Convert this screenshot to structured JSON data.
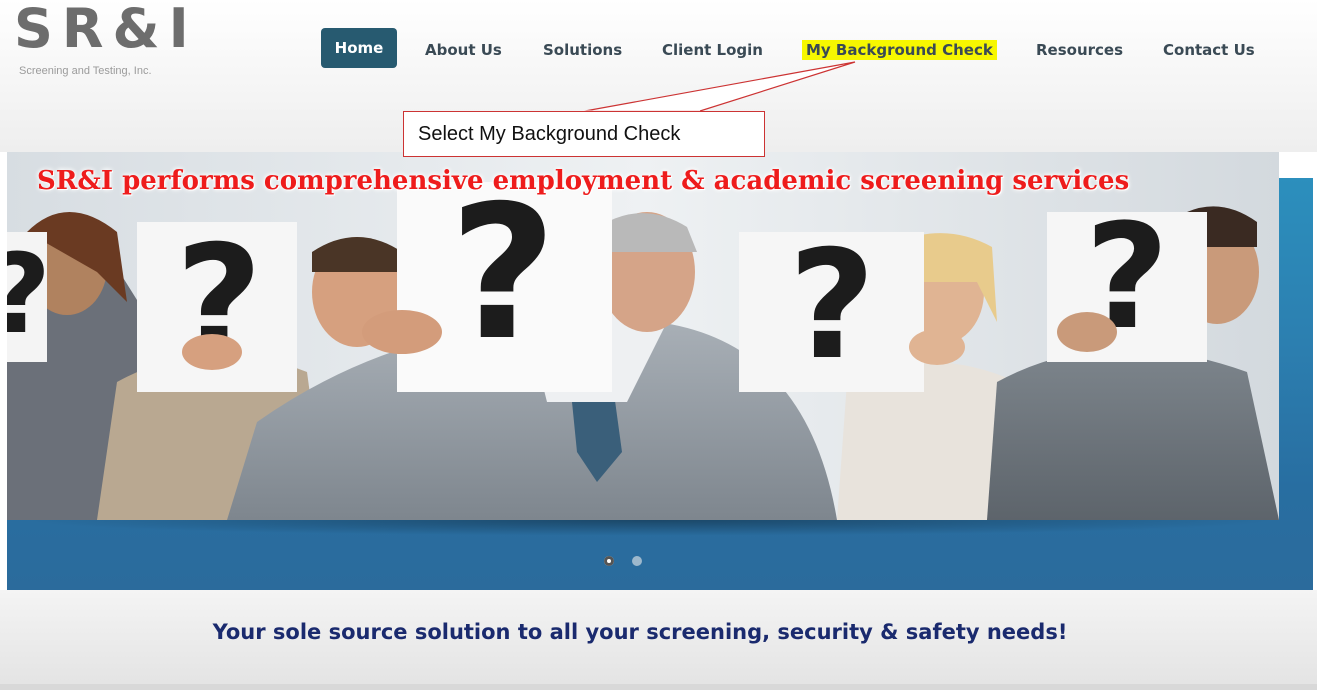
{
  "logo": {
    "mark": "SR&I",
    "subtitle": "Screening and Testing, Inc."
  },
  "nav": {
    "home": "Home",
    "about": "About Us",
    "solutions": "Solutions",
    "client_login": "Client Login",
    "my_background_check": "My Background Check",
    "resources": "Resources",
    "contact": "Contact Us"
  },
  "annotation": {
    "callout_text": "Select My Background Check",
    "highlight_color": "#f7f700",
    "callout_border_color": "#cc3333"
  },
  "slider": {
    "headline": "SR&I performs comprehensive employment & academic screening services",
    "question_mark": "?",
    "current_slide": 1,
    "slide_count": 2
  },
  "tagline": "Your sole source solution to all your screening, security & safety needs!",
  "colors": {
    "nav_active_bg": "#275a70",
    "headline": "#ee1c1c",
    "tagline": "#1a2a6e",
    "band": "#2c7fb0"
  }
}
